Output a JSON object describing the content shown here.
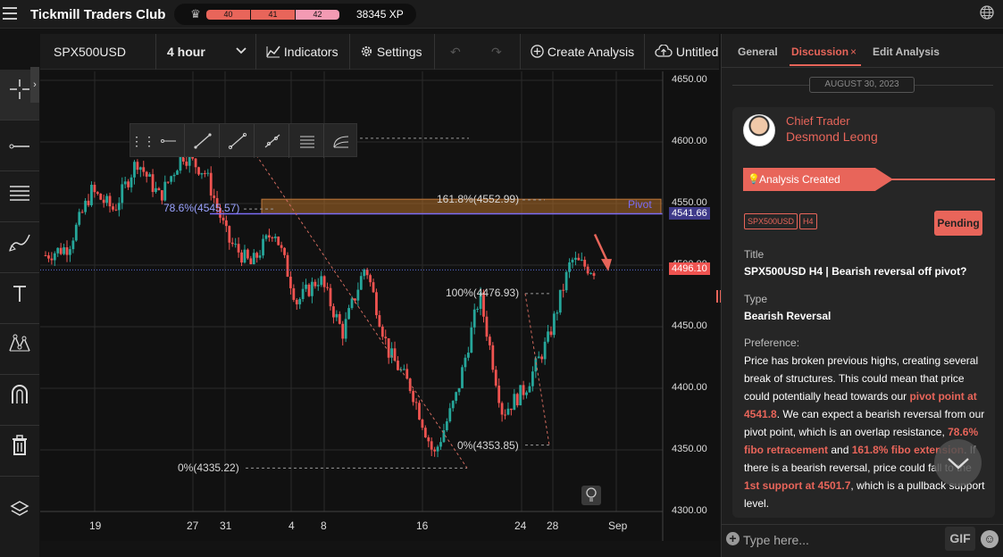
{
  "app": {
    "brand": "Tickmill Traders Club",
    "xp_levels": [
      "40",
      "41",
      "42"
    ],
    "xp_total": "38345 XP"
  },
  "toolbar": {
    "symbol": "SPX500USD",
    "timeframe": "4 hour",
    "indicators": "Indicators",
    "settings": "Settings",
    "create_analysis": "Create Analysis",
    "untitled": "Untitled"
  },
  "left_tools": [
    "crosshair-icon",
    "horizontal-line-icon",
    "fibonacci-icon",
    "brush-icon",
    "text-icon",
    "pattern-icon",
    "magnet-icon",
    "trash-icon",
    "layers-icon"
  ],
  "drawing_toolbar": [
    "drag-handle-icon",
    "ray-icon",
    "pen-icon",
    "trend-line-icon",
    "extended-line-icon",
    "parallel-channel-icon",
    "fib-fan-icon"
  ],
  "chart": {
    "price_labels": [
      "4650.00",
      "4600.00",
      "4550.00",
      "4500.00",
      "4450.00",
      "4400.00",
      "4350.00",
      "4300.00"
    ],
    "date_labels": [
      "19",
      "27",
      "31",
      "4",
      "8",
      "16",
      "24",
      "28",
      "Sep"
    ],
    "pivot_label": "Pivot",
    "pivot_price": "4541.66",
    "current_price": "4496.10",
    "fib_1618": "161.8%(4552.99)",
    "fib_786": "78.6%(4545.57)",
    "fib_100": "100%(4476.93)",
    "fib_0_low": "0%(4353.85)",
    "fib_0": "0%(4335.22)"
  },
  "chart_data": {
    "type": "candlestick",
    "symbol": "SPX500USD",
    "timeframe": "4 hour",
    "ylim": [
      4300,
      4650
    ],
    "y_ticks": [
      4300,
      4350,
      4400,
      4450,
      4500,
      4550,
      4600,
      4650
    ],
    "x_ticks": [
      "19",
      "27",
      "31",
      "4",
      "8",
      "16",
      "24",
      "28",
      "Sep"
    ],
    "annotations": [
      {
        "label": "161.8%(4552.99)",
        "price": 4552.99
      },
      {
        "label": "78.6%(4545.57)",
        "price": 4545.57
      },
      {
        "label": "100%(4476.93)",
        "price": 4476.93
      },
      {
        "label": "0%(4353.85)",
        "price": 4353.85
      },
      {
        "label": "0%(4335.22)",
        "price": 4335.22
      },
      {
        "label": "Pivot",
        "price": 4541.66
      },
      {
        "label": "current",
        "price": 4496.1
      }
    ],
    "approx_path": [
      {
        "x": "17",
        "y": 4508
      },
      {
        "x": "19",
        "y": 4515
      },
      {
        "x": "21",
        "y": 4560
      },
      {
        "x": "24",
        "y": 4545
      },
      {
        "x": "27",
        "y": 4585
      },
      {
        "x": "29",
        "y": 4555
      },
      {
        "x": "31",
        "y": 4590
      },
      {
        "x": "1",
        "y": 4575
      },
      {
        "x": "3",
        "y": 4520
      },
      {
        "x": "4",
        "y": 4500
      },
      {
        "x": "6",
        "y": 4530
      },
      {
        "x": "8",
        "y": 4470
      },
      {
        "x": "10",
        "y": 4490
      },
      {
        "x": "12",
        "y": 4445
      },
      {
        "x": "14",
        "y": 4500
      },
      {
        "x": "16",
        "y": 4430
      },
      {
        "x": "18",
        "y": 4400
      },
      {
        "x": "20",
        "y": 4345
      },
      {
        "x": "22",
        "y": 4395
      },
      {
        "x": "24",
        "y": 4476
      },
      {
        "x": "26",
        "y": 4380
      },
      {
        "x": "28",
        "y": 4400
      },
      {
        "x": "30",
        "y": 4440
      },
      {
        "x": "31",
        "y": 4504
      },
      {
        "x": "Sep",
        "y": 4496
      }
    ]
  },
  "panel": {
    "tabs": [
      "General",
      "Discussion",
      "Edit Analysis"
    ],
    "tab_close": "×",
    "date": "AUGUST 30, 2023",
    "role": "Chief Trader",
    "author": "Desmond Leong",
    "created": "Analysis Created",
    "chips": [
      "SPX500USD",
      "H4"
    ],
    "status": "Pending",
    "title_label": "Title",
    "title_value": "SPX500USD H4 | Bearish reversal off pivot?",
    "type_label": "Type",
    "type_value": "Bearish Reversal",
    "preference_label": "Preference:",
    "body": [
      {
        "t": "Price has broken previous highs, creating several break of structures. This could mean that price could potentially head towards our ",
        "h": false
      },
      {
        "t": "pivot point at 4541.8",
        "h": true
      },
      {
        "t": ". We can expect a bearish reversal from our pivot point, which is an overlap resistance, ",
        "h": false
      },
      {
        "t": "78.6% fibo retracement",
        "h": true
      },
      {
        "t": " and ",
        "h": false
      },
      {
        "t": "161.8% fibo extension",
        "h": true
      },
      {
        "t": ". If there is a bearish reversal, price could fall to the ",
        "h": false
      },
      {
        "t": "1st support at 4501.7",
        "h": true
      },
      {
        "t": ", which is a pullback support level.",
        "h": false
      }
    ],
    "input_placeholder": "Type here...",
    "gif": "GIF"
  },
  "colors": {
    "accent": "#e8655a",
    "up": "#26a69a",
    "down": "#ef5350",
    "pivot": "#7b6cf6"
  }
}
